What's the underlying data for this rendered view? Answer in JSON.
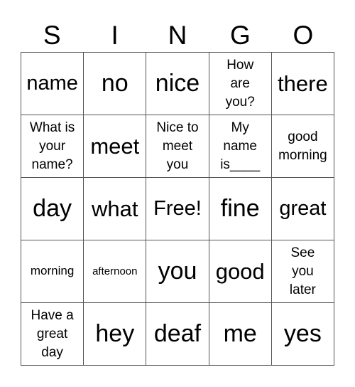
{
  "card": {
    "header": [
      "S",
      "I",
      "N",
      "G",
      "O"
    ],
    "rows": [
      [
        {
          "text": "name",
          "size": "s-md"
        },
        {
          "text": "no",
          "size": "s-xl"
        },
        {
          "text": "nice",
          "size": "s-xl"
        },
        {
          "text": "How are you?",
          "size": "s-sm",
          "lines": [
            "How",
            "are",
            "you?"
          ]
        },
        {
          "text": "there",
          "size": "s-lg"
        }
      ],
      [
        {
          "text": "What is your name?",
          "size": "s-sm",
          "lines": [
            "What is",
            "your",
            "name?"
          ]
        },
        {
          "text": "meet",
          "size": "s-lg"
        },
        {
          "text": "Nice to meet you",
          "size": "s-sm",
          "lines": [
            "Nice to",
            "meet",
            "you"
          ]
        },
        {
          "text": "My name is____",
          "size": "s-sm",
          "lines": [
            "My",
            "name",
            "is____"
          ]
        },
        {
          "text": "good morning",
          "size": "s-sm",
          "lines": [
            "good",
            "morning"
          ]
        }
      ],
      [
        {
          "text": "day",
          "size": "s-xl"
        },
        {
          "text": "what",
          "size": "s-lg"
        },
        {
          "text": "Free!",
          "size": "s-md"
        },
        {
          "text": "fine",
          "size": "s-xl"
        },
        {
          "text": "great",
          "size": "s-md"
        }
      ],
      [
        {
          "text": "morning",
          "size": "s-xs"
        },
        {
          "text": "afternoon",
          "size": "s-xxs"
        },
        {
          "text": "you",
          "size": "s-xl"
        },
        {
          "text": "good",
          "size": "s-lg"
        },
        {
          "text": "See you later",
          "size": "s-sm",
          "lines": [
            "See",
            "you",
            "later"
          ]
        }
      ],
      [
        {
          "text": "Have a great day",
          "size": "s-sm",
          "lines": [
            "Have a",
            "great",
            "day"
          ]
        },
        {
          "text": "hey",
          "size": "s-xl"
        },
        {
          "text": "deaf",
          "size": "s-xl"
        },
        {
          "text": "me",
          "size": "s-xl"
        },
        {
          "text": "yes",
          "size": "s-xl"
        }
      ]
    ]
  }
}
